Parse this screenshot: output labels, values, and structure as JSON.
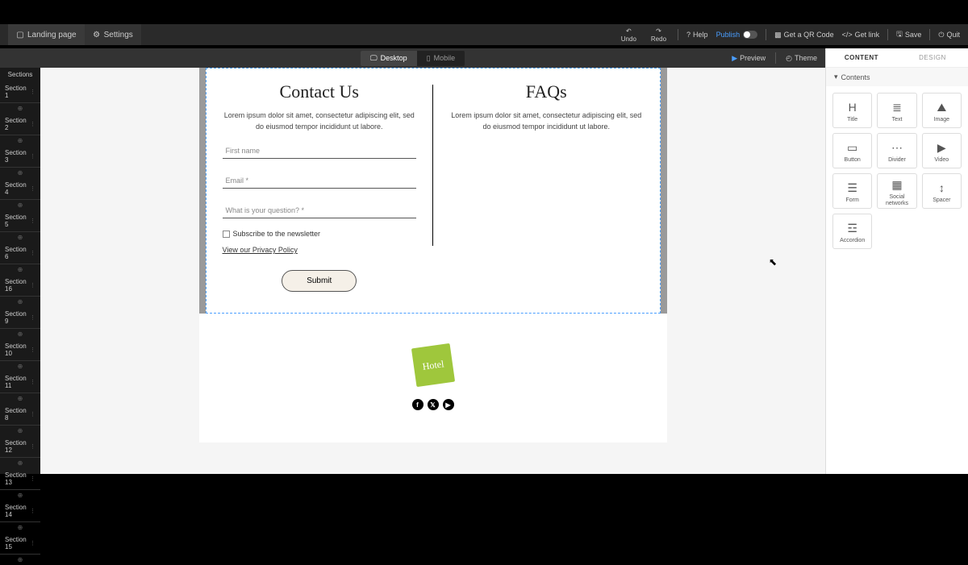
{
  "topbar": {
    "landing_page": "Landing page",
    "settings": "Settings",
    "undo": "Undo",
    "redo": "Redo",
    "help": "Help",
    "publish": "Publish",
    "qr": "Get a QR Code",
    "getlink": "Get link",
    "save": "Save",
    "quit": "Quit"
  },
  "viewbar": {
    "desktop": "Desktop",
    "mobile": "Mobile",
    "preview": "Preview",
    "theme": "Theme"
  },
  "sections": {
    "header": "Sections",
    "items": [
      "Section 1",
      "Section 2",
      "Section 3",
      "Section 4",
      "Section 5",
      "Section 6",
      "Section 16",
      "Section 9",
      "Section 10",
      "Section 11",
      "Section 8",
      "Section 12",
      "Section 13",
      "Section 14",
      "Section 15"
    ]
  },
  "contact": {
    "title": "Contact Us",
    "desc": "Lorem ipsum dolor sit amet, consectetur adipiscing elit, sed do eiusmod tempor incididunt ut labore.",
    "first_name_ph": "First name",
    "email_ph": "Email *",
    "question_ph": "What is your question? *",
    "subscribe": "Subscribe to the newsletter",
    "policy": "View our Privacy Policy",
    "submit": "Submit"
  },
  "faqs": {
    "title": "FAQs",
    "desc": "Lorem ipsum dolor sit amet, consectetur adipiscing elit, sed do eiusmod tempor incididunt ut labore."
  },
  "footer": {
    "logo_text": "Hotel"
  },
  "right_panel": {
    "tab_content": "CONTENT",
    "tab_design": "DESIGN",
    "contents_head": "Contents",
    "tiles": [
      {
        "label": "Title",
        "icon": "H"
      },
      {
        "label": "Text",
        "icon": "≣"
      },
      {
        "label": "Image",
        "icon": "⛰"
      },
      {
        "label": "Button",
        "icon": "▭"
      },
      {
        "label": "Divider",
        "icon": "⋯"
      },
      {
        "label": "Video",
        "icon": "▶"
      },
      {
        "label": "Form",
        "icon": "☰"
      },
      {
        "label": "Social networks",
        "icon": "▦"
      },
      {
        "label": "Spacer",
        "icon": "↕"
      },
      {
        "label": "Accordion",
        "icon": "☲"
      }
    ]
  }
}
